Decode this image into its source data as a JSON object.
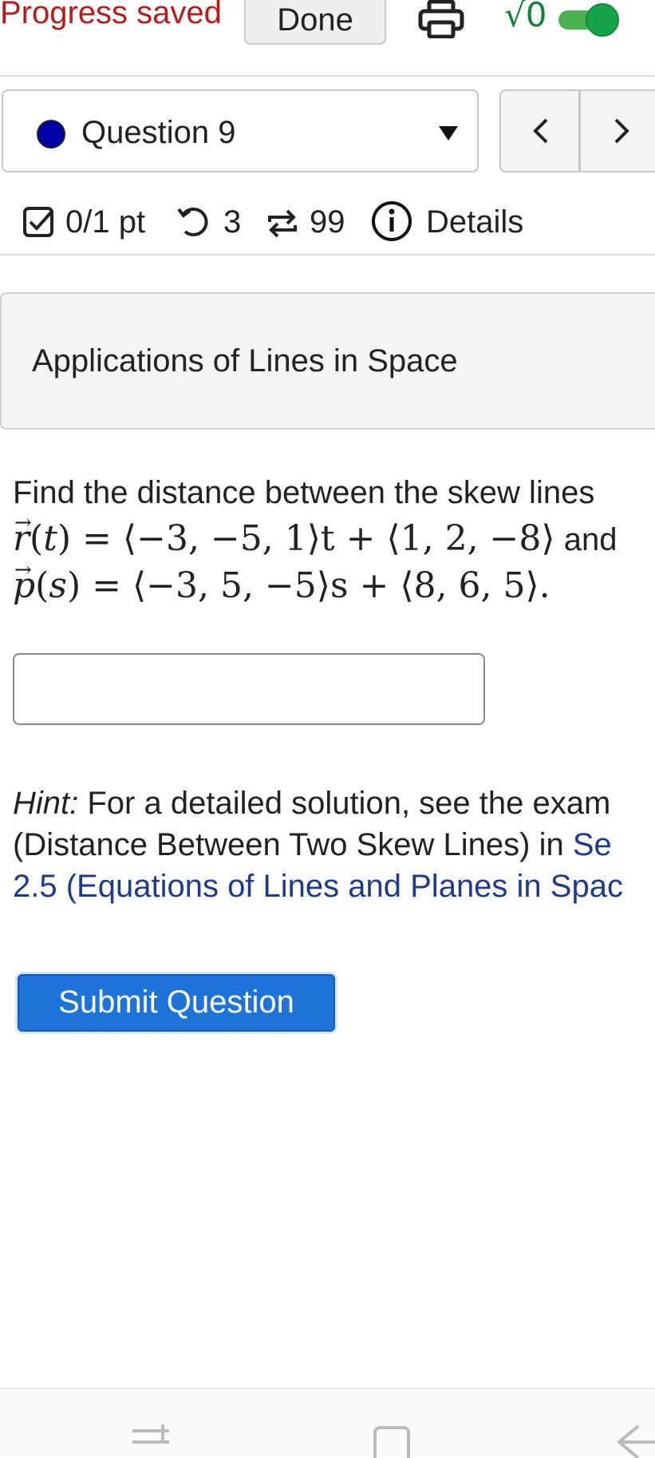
{
  "topbar": {
    "progress_status": "Progress saved",
    "done_label": "Done",
    "math_toggle_label": "√0",
    "math_toggle_on": true
  },
  "question_selector": {
    "selected": "Question 9",
    "status_color": "#0000a8"
  },
  "nav": {
    "prev_label": "<",
    "next_label": ">"
  },
  "score": {
    "points": "0/1 pt",
    "retries": "3",
    "attempts": "99",
    "details_label": "Details"
  },
  "topic": {
    "title": "Applications of Lines in Space"
  },
  "question": {
    "intro": "Find the distance between the skew lines",
    "line1": {
      "lhs": "r(t) = ",
      "expr": "⟨−3, −5, 1⟩t + ⟨1, 2, −8⟩",
      "connector": "and"
    },
    "line2": {
      "lhs": "p(s) = ",
      "expr": "⟨−3, 5, −5⟩s + ⟨8, 6, 5⟩."
    },
    "answer_value": ""
  },
  "hint": {
    "label": "Hint:",
    "text_line1": " For a detailed solution, see the exam",
    "text_line2": "(Distance Between Two Skew Lines) in ",
    "link_line2": "Se",
    "link_line3": "2.5 (Equations of Lines and Planes in Spac"
  },
  "submit_label": "Submit Question",
  "colors": {
    "progress_saved": "#b91c1c",
    "toggle_on": "#16a34a",
    "submit_bg": "#1e73d8",
    "link": "#1e3a8a"
  },
  "icons": [
    "print-icon",
    "checkbox-icon",
    "retry-icon",
    "attempts-icon",
    "info-icon",
    "recent-apps-icon",
    "home-icon",
    "back-icon"
  ]
}
